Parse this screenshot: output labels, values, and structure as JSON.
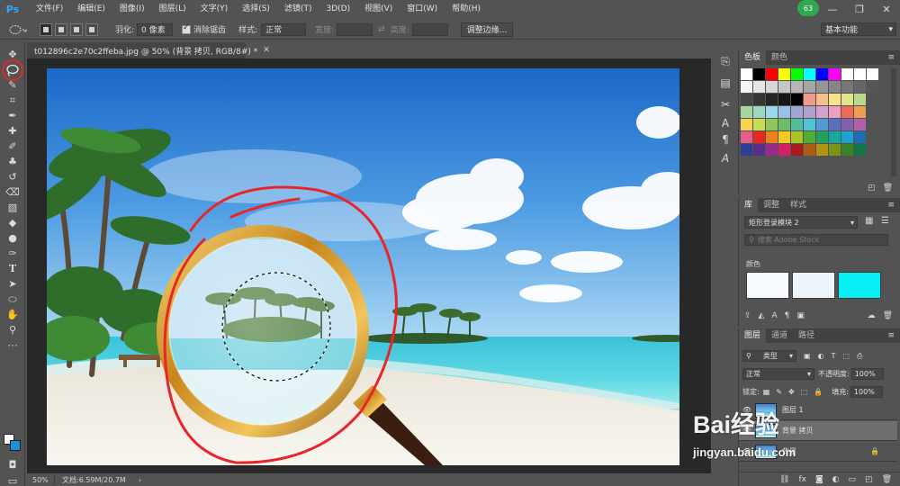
{
  "app": {
    "logo": "Ps",
    "user_badge": "63"
  },
  "menu": [
    "文件(F)",
    "编辑(E)",
    "图像(I)",
    "图层(L)",
    "文字(Y)",
    "选择(S)",
    "滤镜(T)",
    "3D(D)",
    "视图(V)",
    "窗口(W)",
    "帮助(H)"
  ],
  "window_controls": {
    "minimize": "—",
    "maximize": "❐",
    "close": "✕"
  },
  "options": {
    "feather_label": "羽化:",
    "feather_value": "0 像素",
    "antialias_label": "消除锯齿",
    "style_label": "样式:",
    "style_value": "正常",
    "width_label": "宽度:",
    "height_label": "高度:",
    "refine_edge": "调整边缘..."
  },
  "workspace": "基本功能",
  "document": {
    "tab_title": "t012896c2e70c2ffeba.jpg @ 50% (背景 拷贝, RGB/8#) *",
    "zoom": "50%",
    "doc_size": "文档:6.59M/20.7M"
  },
  "tools": [
    "move",
    "lasso",
    "quick-select",
    "crop",
    "eyedropper",
    "healing",
    "brush",
    "stamp",
    "history-brush",
    "eraser",
    "gradient",
    "blur",
    "dodge",
    "pen",
    "type",
    "path-select",
    "shape",
    "hand",
    "zoom"
  ],
  "swatches_panel": {
    "tabs": [
      "色板",
      "颜色"
    ],
    "rows": [
      [
        "#ffffff",
        "#000000",
        "#ff0000",
        "#ffff00",
        "#00ff00",
        "#00ffff",
        "#0000ff",
        "#ff00ff",
        "#ffffff",
        "#ffffff",
        "#ffffff"
      ],
      [
        "#f5f5f5",
        "#e6e6e6",
        "#d6d6d6",
        "#c6c6c6",
        "#b6b6b6",
        "#a6a6a6",
        "#969696",
        "#868686",
        "#767676",
        "#666666",
        "#565656"
      ],
      [
        "#464646",
        "#363636",
        "#262626",
        "#161616",
        "#000000",
        "#ee9a8c",
        "#f8be8a",
        "#f9e28e",
        "#dee58d",
        "#b7d88f"
      ],
      [
        "#a9d6a0",
        "#9ed6c0",
        "#98d9ea",
        "#98c1e4",
        "#9ea6d6",
        "#b29ecf",
        "#d3a1cd",
        "#ec9fc1",
        "#ee6a57",
        "#f39c54"
      ],
      [
        "#f7d251",
        "#c8dc53",
        "#8fc655",
        "#6ebc68",
        "#52bb9d",
        "#4fc3d8",
        "#519ad4",
        "#5a6fbb",
        "#8260ae",
        "#b160a9"
      ],
      [
        "#e35d8d",
        "#e52b21",
        "#ee7f1c",
        "#f7c91c",
        "#a7c724",
        "#50af33",
        "#21a15c",
        "#1aa7a0",
        "#1ba3d2",
        "#1f6cb2"
      ],
      [
        "#2c3f93",
        "#5a2c8b",
        "#9a2987",
        "#d4206b",
        "#a71c1a",
        "#ad5b12",
        "#b39410",
        "#7a9516",
        "#3a8224",
        "#117646"
      ]
    ]
  },
  "libraries_panel": {
    "tabs": [
      "库",
      "调整",
      "样式"
    ],
    "library_select": "矩形登录模块 2",
    "search_placeholder": "搜索 Adobe Stock",
    "colors_label": "颜色",
    "colors": [
      "#f7fbff",
      "#eef5fa",
      "#06eff5"
    ]
  },
  "layers_panel": {
    "tabs": [
      "图层",
      "通道",
      "路径"
    ],
    "kind_select": "类型",
    "blend_mode": "正常",
    "opacity_label": "不透明度:",
    "opacity_value": "100%",
    "lock_label": "锁定:",
    "fill_label": "填充:",
    "fill_value": "100%",
    "layers": [
      {
        "name": "图层 1"
      },
      {
        "name": "背景 拷贝"
      },
      {
        "name": "背景"
      }
    ]
  },
  "watermark": {
    "brand": "Bai经验",
    "url": "jingyan.baidu.com"
  }
}
